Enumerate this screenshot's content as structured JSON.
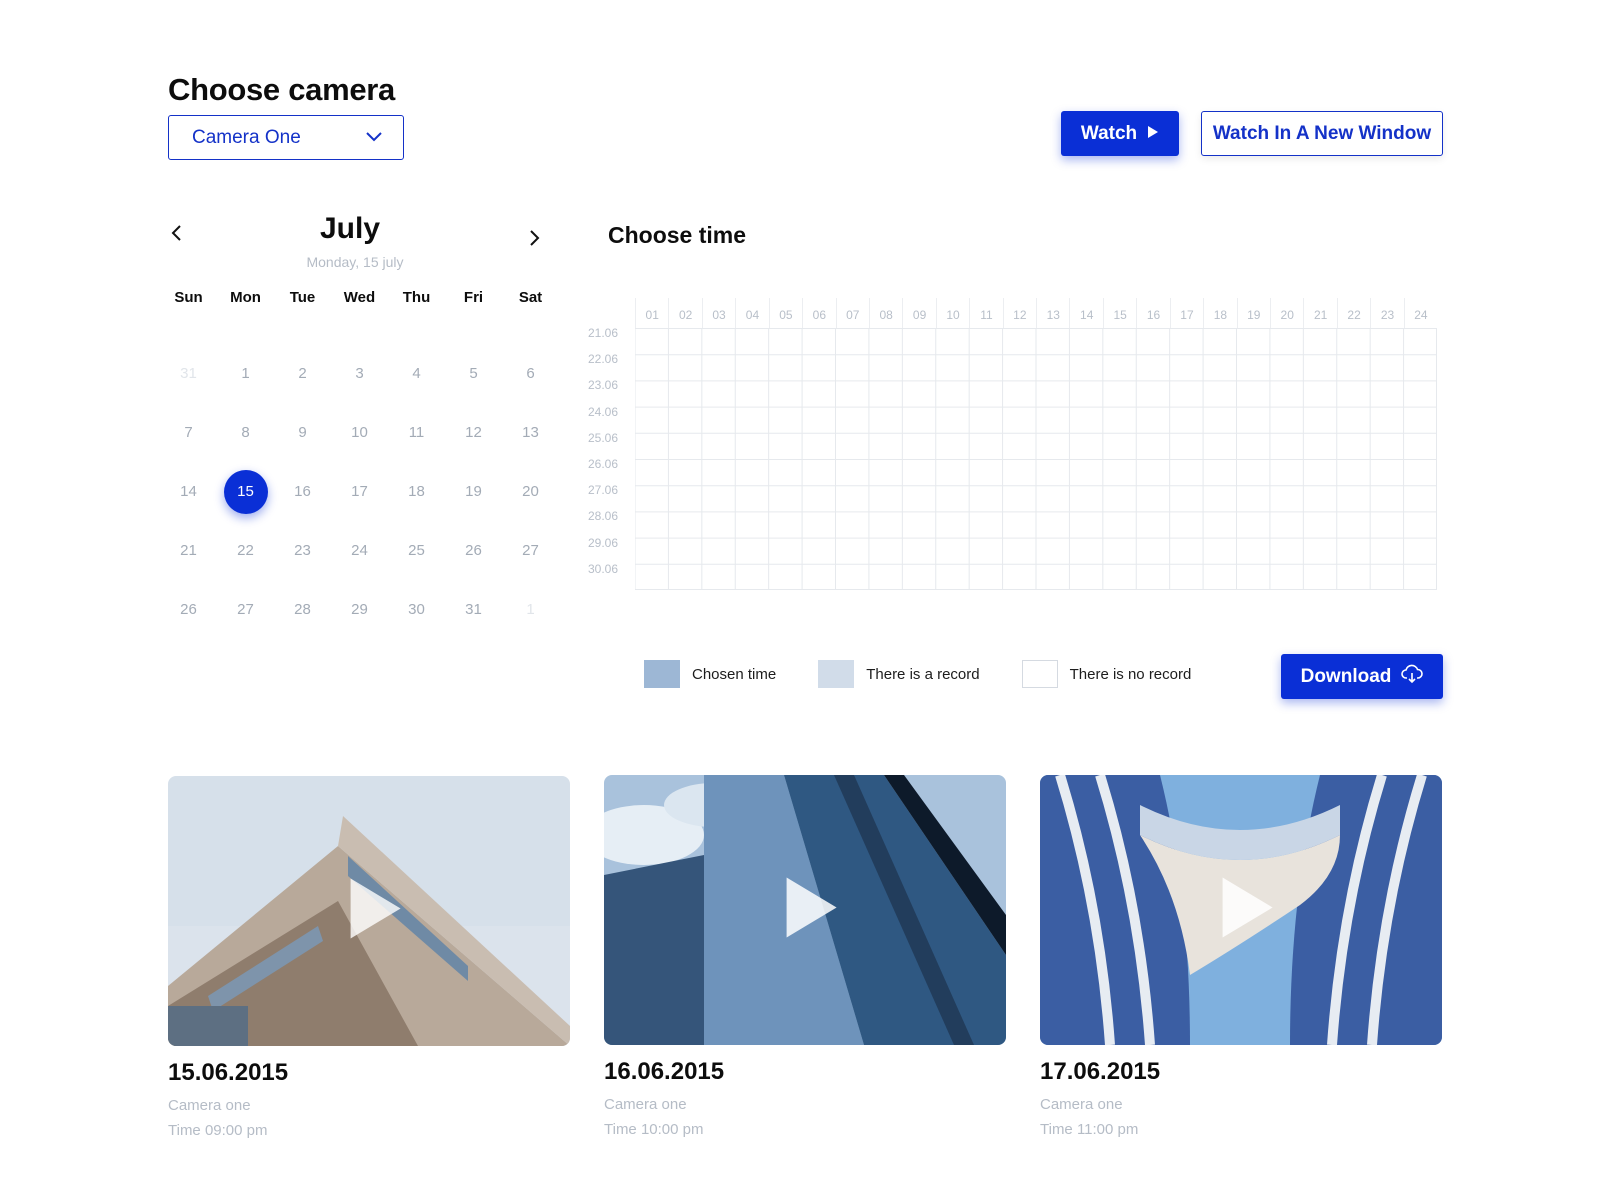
{
  "header": {
    "title": "Choose camera",
    "camera_selected": "Camera One",
    "watch_label": "Watch",
    "watch_new_window_label": "Watch In A New Window"
  },
  "calendar": {
    "month": "July",
    "selected_date_text": "Monday, 15 july",
    "weekdays": [
      "Sun",
      "Mon",
      "Tue",
      "Wed",
      "Thu",
      "Fri",
      "Sat"
    ],
    "weeks": [
      [
        {
          "d": "31",
          "muted": true
        },
        {
          "d": "1"
        },
        {
          "d": "2"
        },
        {
          "d": "3"
        },
        {
          "d": "4"
        },
        {
          "d": "5"
        },
        {
          "d": "6"
        }
      ],
      [
        {
          "d": "7"
        },
        {
          "d": "8"
        },
        {
          "d": "9"
        },
        {
          "d": "10"
        },
        {
          "d": "11"
        },
        {
          "d": "12"
        },
        {
          "d": "13"
        }
      ],
      [
        {
          "d": "14"
        },
        {
          "d": "15",
          "selected": true
        },
        {
          "d": "16"
        },
        {
          "d": "17"
        },
        {
          "d": "18"
        },
        {
          "d": "19"
        },
        {
          "d": "20"
        }
      ],
      [
        {
          "d": "21"
        },
        {
          "d": "22"
        },
        {
          "d": "23"
        },
        {
          "d": "24"
        },
        {
          "d": "25"
        },
        {
          "d": "26"
        },
        {
          "d": "27"
        }
      ],
      [
        {
          "d": "26"
        },
        {
          "d": "27"
        },
        {
          "d": "28"
        },
        {
          "d": "29"
        },
        {
          "d": "30"
        },
        {
          "d": "31"
        },
        {
          "d": "1",
          "muted": true
        }
      ]
    ],
    "accent_color": "#0a2fd6"
  },
  "time_picker": {
    "title": "Choose time",
    "hours": [
      "01",
      "02",
      "03",
      "04",
      "05",
      "06",
      "07",
      "08",
      "09",
      "10",
      "11",
      "12",
      "13",
      "14",
      "15",
      "16",
      "17",
      "18",
      "19",
      "20",
      "21",
      "22",
      "23",
      "24"
    ],
    "dates": [
      "21.06",
      "22.06",
      "23.06",
      "24.06",
      "25.06",
      "26.06",
      "27.06",
      "28.06",
      "29.06",
      "30.06"
    ]
  },
  "legend": {
    "chosen": "Chosen time",
    "record": "There is a record",
    "no_record": "There is no record",
    "chosen_color": "#9db7d5",
    "record_color": "#d1dce9"
  },
  "download_label": "Download",
  "videos": [
    {
      "date": "15.06.2015",
      "camera": "Camera one",
      "time": "Time 09:00 pm"
    },
    {
      "date": "16.06.2015",
      "camera": "Camera one",
      "time": "Time 10:00 pm"
    },
    {
      "date": "17.06.2015",
      "camera": "Camera one",
      "time": "Time 11:00 pm"
    }
  ]
}
